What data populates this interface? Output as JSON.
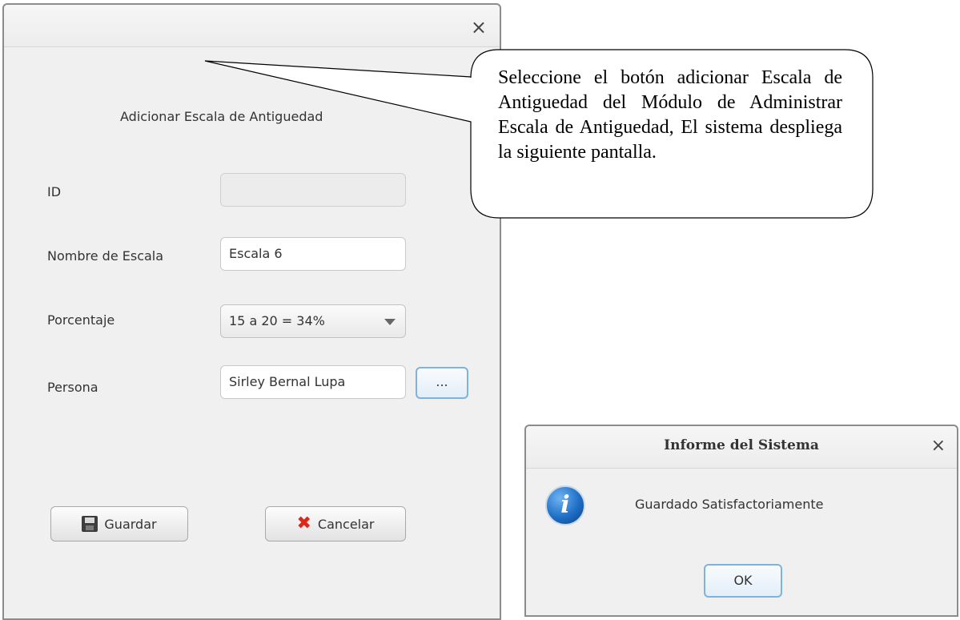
{
  "main_dialog": {
    "close_label": "×",
    "heading": "Adicionar Escala de Antiguedad",
    "fields": {
      "id": {
        "label": "ID",
        "value": ""
      },
      "nombre": {
        "label": "Nombre de Escala",
        "value": "Escala 6"
      },
      "porcentaje": {
        "label": "Porcentaje",
        "selected": "15 a 20 = 34%"
      },
      "persona": {
        "label": "Persona",
        "value": "Sirley Bernal Lupa",
        "browse_label": "..."
      }
    },
    "buttons": {
      "save": "Guardar",
      "cancel": "Cancelar"
    }
  },
  "callout": {
    "text": "Seleccione el botón adicionar Escala de Antiguedad del Módulo de Administrar Escala de Antiguedad, El sistema despliega la siguiente pantalla."
  },
  "info_dialog": {
    "title": "Informe del Sistema",
    "close_label": "×",
    "icon": "info-icon",
    "icon_glyph": "i",
    "message": "Guardado Satisfactoriamente",
    "ok": "OK"
  },
  "icons": {
    "save": "floppy-disk-icon",
    "cancel": "red-x-icon",
    "dropdown": "chevron-down-icon"
  },
  "colors": {
    "dialog_bg": "#f0f0f0",
    "focus_border": "#7fb2dc",
    "cancel_icon": "#d92a1c",
    "info_icon": "#1f6fc6"
  }
}
